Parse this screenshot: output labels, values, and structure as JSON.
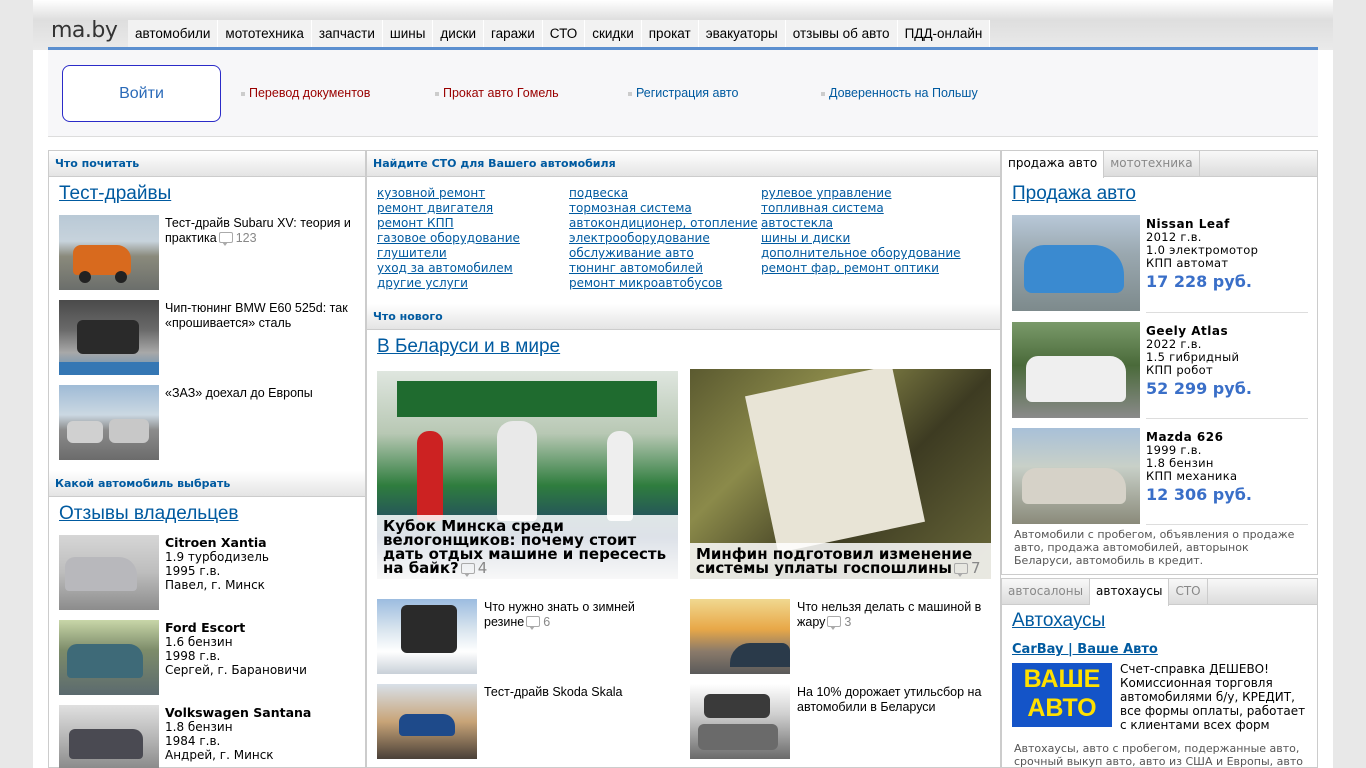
{
  "site": {
    "logo": "ma.by",
    "nav": [
      "автомобили",
      "мототехника",
      "запчасти",
      "шины",
      "диски",
      "гаражи",
      "СТО",
      "скидки",
      "прокат",
      "эвакуаторы",
      "отзывы об авто",
      "ПДД-онлайн"
    ]
  },
  "login": {
    "label": "Войти"
  },
  "promos": [
    {
      "label": "Перевод документов",
      "color": "#990000"
    },
    {
      "label": "Прокат авто Гомель",
      "color": "#990000"
    },
    {
      "label": "Регистрация авто",
      "color": "#005aa0"
    },
    {
      "label": "Доверенность на Польшу",
      "color": "#005aa0"
    }
  ],
  "left": {
    "read_head": "Что почитать",
    "tests_title": "Тест-драйвы",
    "tests": [
      {
        "title": "Тест-драйв Subaru XV: теория и практика",
        "comments": "123"
      },
      {
        "title": "Чип-тюнинг BMW E60 525d: так «прошивается» сталь",
        "comments": ""
      },
      {
        "title": "«ЗАЗ» доехал до Европы",
        "comments": ""
      }
    ],
    "choose_head": "Какой автомобиль выбрать",
    "reviews_title": "Отзывы владельцев",
    "reviews": [
      {
        "car": "Citroen Xantia",
        "engine": "1.9 турбодизель",
        "year": "1995 г.в.",
        "author": "Павел, г. Минск"
      },
      {
        "car": "Ford Escort",
        "engine": "1.6 бензин",
        "year": "1998 г.в.",
        "author": "Сергей, г. Барановичи"
      },
      {
        "car": "Volkswagen Santana",
        "engine": "1.8 бензин",
        "year": "1984 г.в.",
        "author": "Андрей, г. Минск"
      }
    ]
  },
  "middle": {
    "sto_head": "Найдите СТО для Вашего автомобиля",
    "sto_cols": [
      [
        "кузовной ремонт",
        "ремонт двигателя",
        "ремонт КПП",
        "газовое оборудование",
        "глушители",
        "уход за автомобилем",
        "другие услуги"
      ],
      [
        "подвеска",
        "тормозная система",
        "автокондиционер, отопление",
        "электрооборудование",
        "обслуживание авто",
        "тюнинг автомобилей",
        "ремонт микроавтобусов"
      ],
      [
        "рулевое управление",
        "топливная система",
        "автостекла",
        "шины и диски",
        "дополнительное оборудование",
        "ремонт фар, ремонт оптики"
      ]
    ],
    "news_head": "Что нового",
    "news_title": "В Беларуси и в мире",
    "featured": [
      {
        "title": "Кубок Минска среди велогонщиков: почему стоит дать отдых машине и пересесть на байк?",
        "comments": "4"
      },
      {
        "title": "Минфин подготовил изменение системы уплаты госпошлины",
        "comments": "7"
      }
    ],
    "items": [
      {
        "title": "Что нужно знать о зимней резине",
        "comments": "6"
      },
      {
        "title": "Что нельзя делать с машиной в жару",
        "comments": "3"
      },
      {
        "title": "Тест-драйв Skoda Skala",
        "comments": ""
      },
      {
        "title": "На 10% дорожает утильсбор на автомобили в Беларуси",
        "comments": ""
      }
    ]
  },
  "right": {
    "tabs1": [
      "продажа авто",
      "мототехника"
    ],
    "sale_title": "Продажа авто",
    "sales": [
      {
        "name": "Nissan Leaf",
        "year": "2012 г.в.",
        "engine": "1.0 электромотор",
        "gearbox": "КПП автомат",
        "price": "17 228 руб."
      },
      {
        "name": "Geely Atlas",
        "year": "2022 г.в.",
        "engine": "1.5 гибридный",
        "gearbox": "КПП робот",
        "price": "52 299 руб."
      },
      {
        "name": "Mazda 626",
        "year": "1999 г.в.",
        "engine": "1.8 бензин",
        "gearbox": "КПП механика",
        "price": "12 306 руб."
      }
    ],
    "sale_note": "Автомобили с пробегом, объявления о продаже авто, продажа автомобилей, авторынок Беларуси, автомобиль в кредит.",
    "tabs2": [
      "автосалоны",
      "автохаусы",
      "СТО"
    ],
    "haus_title": "Автохаусы",
    "haus_link": "CarBay | Ваше Авто",
    "haus_logo_line1": "ВАШЕ",
    "haus_logo_line2": "АВТО",
    "haus_desc": "Счет-справка ДЕШЕВО! Комиссионная торговля автомобилями б/у, КРЕДИТ, все формы оплаты, работает с клиентами всех форм",
    "haus_note": "Автохаусы, авто с пробегом, подержанные авто, срочный выкуп авто, авто из США и Европы, авто под"
  }
}
